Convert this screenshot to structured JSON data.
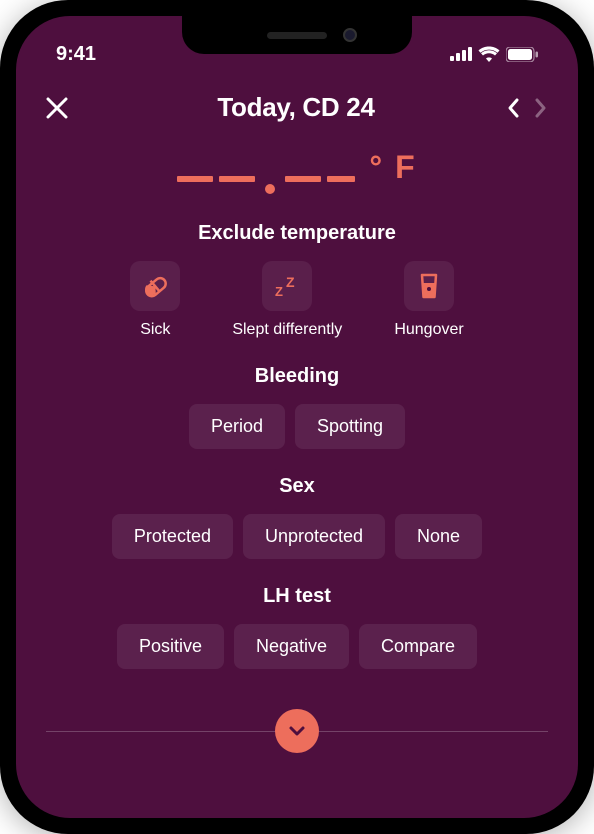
{
  "status": {
    "time": "9:41"
  },
  "header": {
    "title": "Today, CD 24"
  },
  "temperature": {
    "unit": "° F"
  },
  "sections": {
    "exclude": {
      "title": "Exclude temperature",
      "options": {
        "sick": "Sick",
        "slept": "Slept differently",
        "hungover": "Hungover"
      }
    },
    "bleeding": {
      "title": "Bleeding",
      "options": {
        "period": "Period",
        "spotting": "Spotting"
      }
    },
    "sex": {
      "title": "Sex",
      "options": {
        "protected": "Protected",
        "unprotected": "Unprotected",
        "none": "None"
      }
    },
    "lh": {
      "title": "LH test",
      "options": {
        "positive": "Positive",
        "negative": "Negative",
        "compare": "Compare"
      }
    }
  }
}
